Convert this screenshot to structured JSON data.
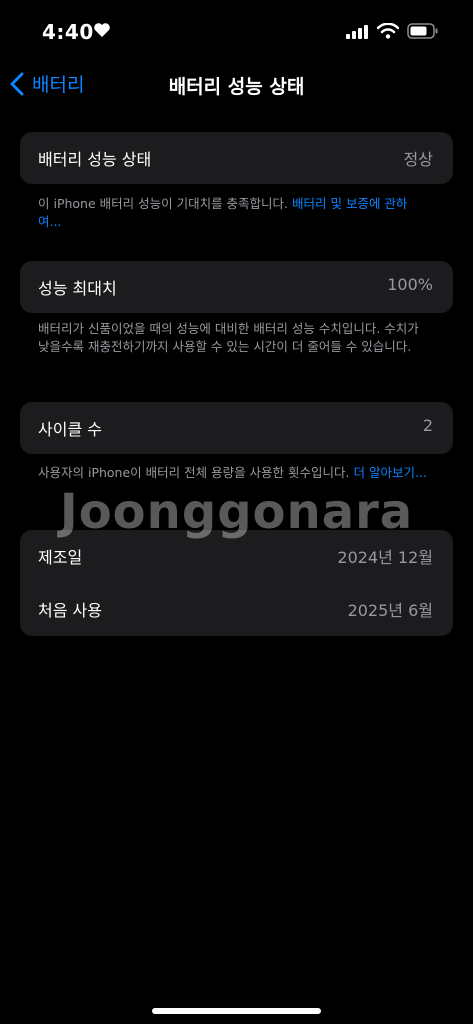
{
  "status": {
    "time": "4:40"
  },
  "nav": {
    "back_label": "배터리",
    "title": "배터리 성능 상태"
  },
  "battery_health": {
    "label": "배터리 성능 상태",
    "value": "정상",
    "note": "이 iPhone 배터리 성능이 기대치를 충족합니다. ",
    "link": "배터리 및 보증에 관하여..."
  },
  "max_capacity": {
    "label": "성능 최대치",
    "value": "100%",
    "note": "배터리가 신품이었을 때의 성능에 대비한 배터리 성능 수치입니다. 수치가 낮을수록 재충전하기까지 사용할 수 있는 시간이 더 줄어들 수 있습니다."
  },
  "cycle_count": {
    "label": "사이클 수",
    "value": "2",
    "note": "사용자의 iPhone이 배터리 전체 용량을 사용한 횟수입니다. ",
    "link": "더 알아보기..."
  },
  "info": {
    "manufactured_label": "제조일",
    "manufactured_value": "2024년 12월",
    "first_use_label": "처음 사용",
    "first_use_value": "2025년 6월"
  },
  "watermark": "Joonggonara",
  "colors": {
    "accent": "#0a84ff",
    "card": "#1c1c1e",
    "secondary_text": "#98989f"
  }
}
